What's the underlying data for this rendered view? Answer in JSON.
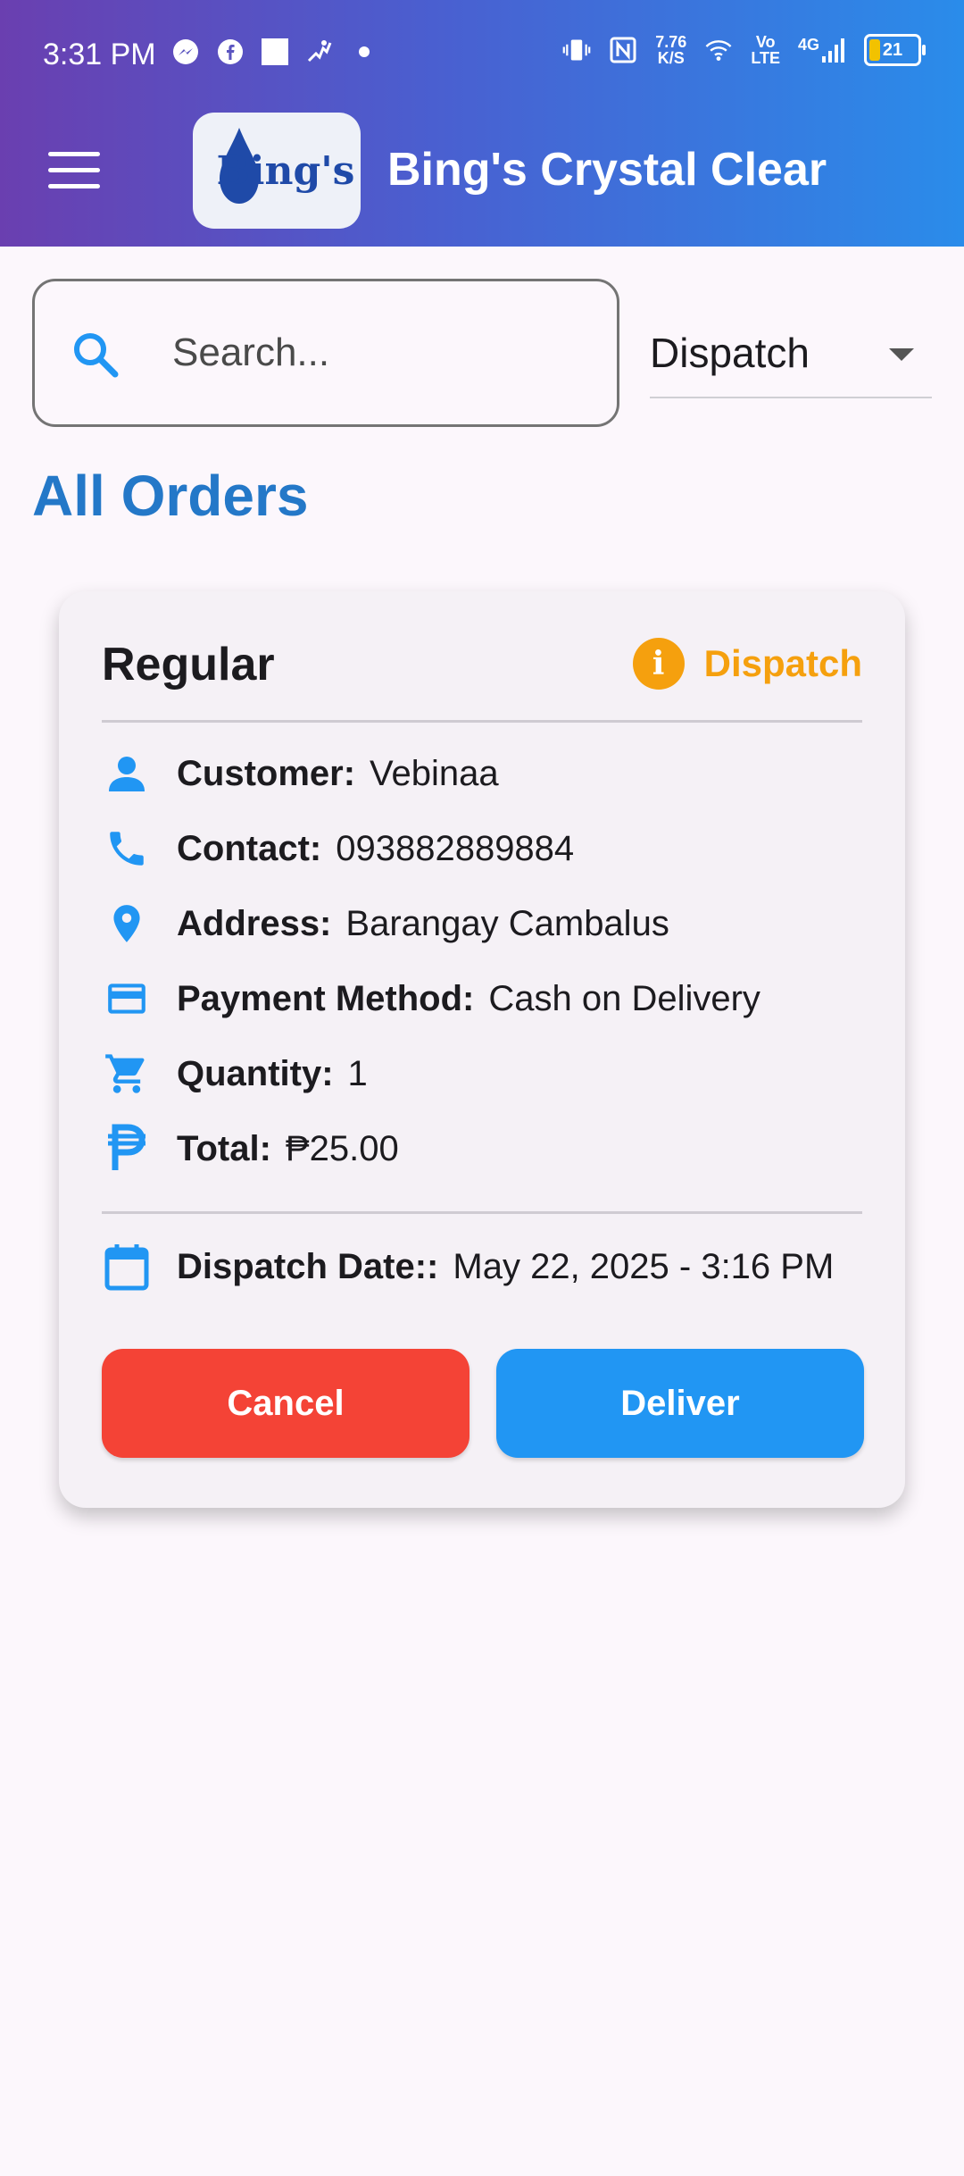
{
  "status_bar": {
    "time": "3:31 PM",
    "speed_top": "7.76",
    "speed_bottom": "K/S",
    "volte_top": "Vo",
    "volte_bottom": "LTE",
    "network": "4G",
    "battery": "21",
    "icons": [
      "messenger-icon",
      "facebook-icon",
      "square-icon",
      "activity-icon",
      "dot-icon",
      "vibrate-icon",
      "nfc-icon",
      "wifi-icon",
      "signal-icon",
      "battery-icon"
    ]
  },
  "app_bar": {
    "logo_text": "Bing's",
    "title": "Bing's Crystal Clear",
    "menu_icon": "hamburger-menu-icon"
  },
  "search": {
    "placeholder": "Search...",
    "value": ""
  },
  "filter": {
    "selected": "Dispatch"
  },
  "section_title": "All Orders",
  "orders": [
    {
      "type": "Regular",
      "status": "Dispatch",
      "customer_label": "Customer:",
      "customer": "Vebinaa",
      "contact_label": "Contact:",
      "contact": "093882889884",
      "address_label": "Address:",
      "address": "Barangay Cambalus",
      "payment_label": "Payment Method:",
      "payment": "Cash on Delivery",
      "quantity_label": "Quantity:",
      "quantity": "1",
      "total_label": "Total:",
      "total": "₱25.00",
      "dispatch_label": "Dispatch Date::",
      "dispatch_date": "May 22, 2025 - 3:16 PM",
      "cancel_label": "Cancel",
      "deliver_label": "Deliver"
    }
  ],
  "colors": {
    "accent_blue": "#2196f3",
    "title_blue": "#2478c8",
    "status_orange": "#f5a00e",
    "cancel_red": "#f44336"
  }
}
